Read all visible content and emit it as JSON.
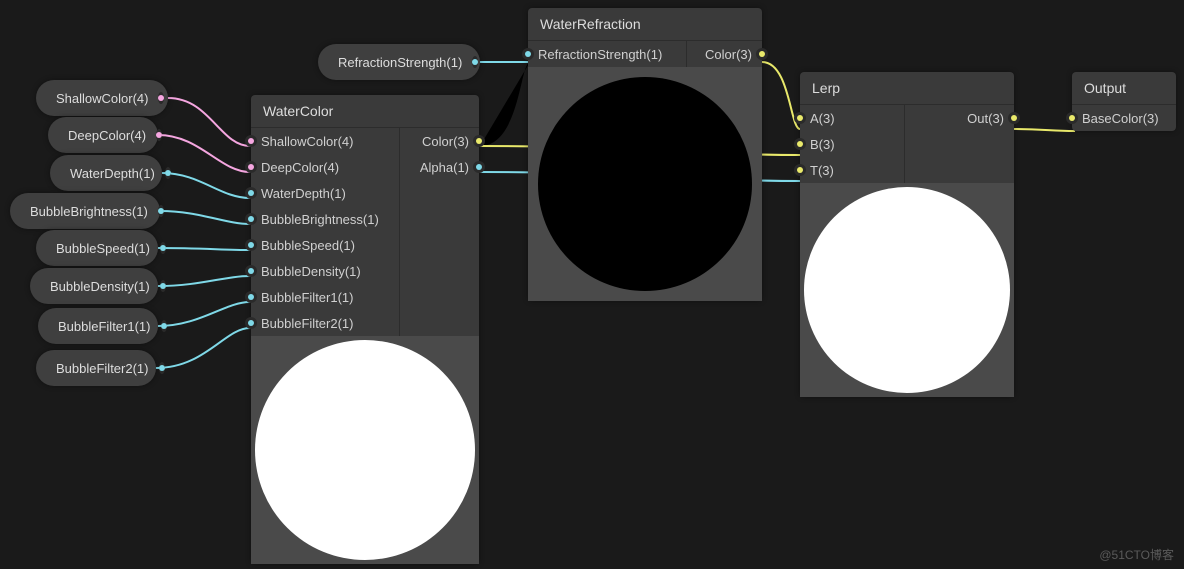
{
  "watermark": "@51CTO博客",
  "pills": {
    "shallow": {
      "label": "ShallowColor(4)"
    },
    "deep": {
      "label": "DeepColor(4)"
    },
    "depth": {
      "label": "WaterDepth(1)"
    },
    "bbright": {
      "label": "BubbleBrightness(1)"
    },
    "bspeed": {
      "label": "BubbleSpeed(1)"
    },
    "bdensity": {
      "label": "BubbleDensity(1)"
    },
    "bf1": {
      "label": "BubbleFilter1(1)"
    },
    "bf2": {
      "label": "BubbleFilter2(1)"
    },
    "rstr": {
      "label": "RefractionStrength(1)"
    }
  },
  "nodes": {
    "watercolor": {
      "title": "WaterColor",
      "inputs": [
        "ShallowColor(4)",
        "DeepColor(4)",
        "WaterDepth(1)",
        "BubbleBrightness(1)",
        "BubbleSpeed(1)",
        "BubbleDensity(1)",
        "BubbleFilter1(1)",
        "BubbleFilter2(1)"
      ],
      "outputs": [
        "Color(3)",
        "Alpha(1)"
      ]
    },
    "waterrefraction": {
      "title": "WaterRefraction",
      "inputs": [
        "RefractionStrength(1)"
      ],
      "outputs": [
        "Color(3)"
      ]
    },
    "lerp": {
      "title": "Lerp",
      "inputs": [
        "A(3)",
        "B(3)",
        "T(3)"
      ],
      "outputs": [
        "Out(3)"
      ]
    },
    "output": {
      "title": "Output",
      "inputs": [
        "BaseColor(3)"
      ]
    }
  }
}
